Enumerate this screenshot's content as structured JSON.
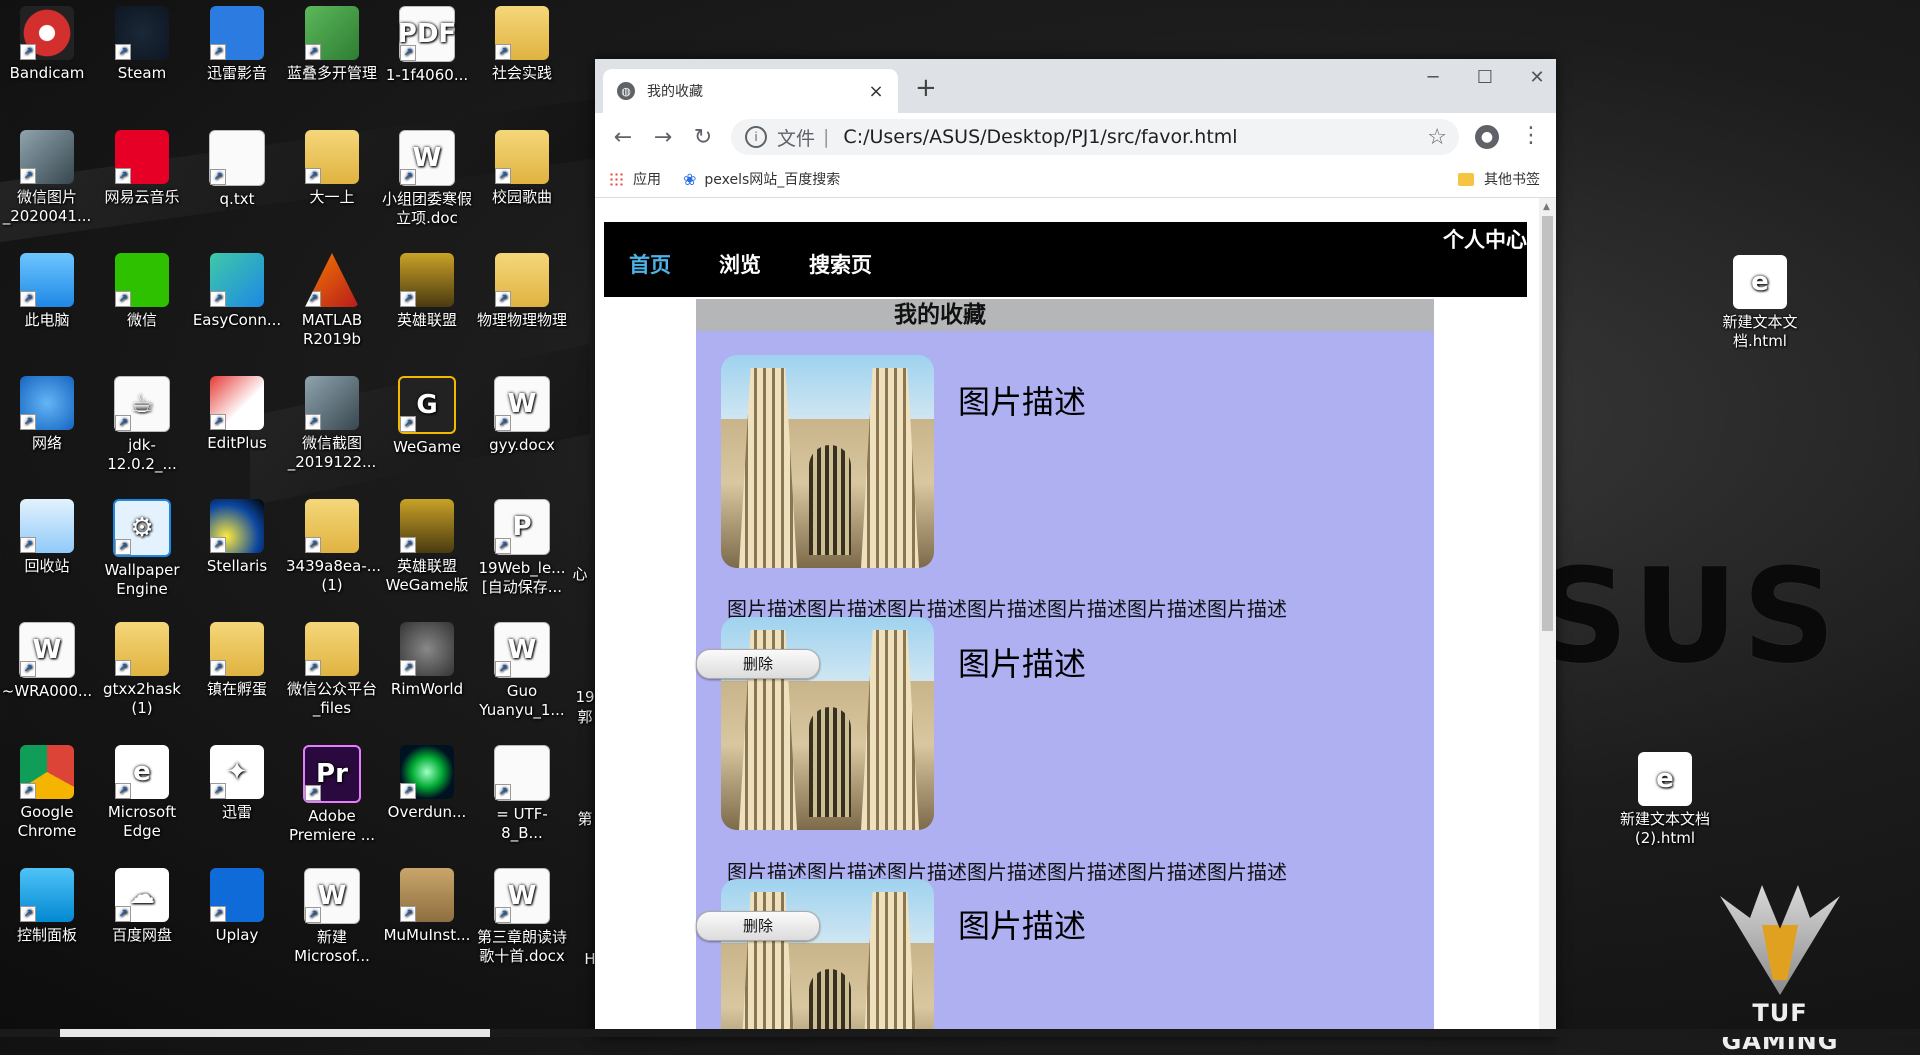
{
  "desktop": {
    "icons": [
      {
        "label": "Bandicam",
        "icon": "bandicam-icon"
      },
      {
        "label": "Steam",
        "icon": "steam-icon"
      },
      {
        "label": "迅雷影音",
        "icon": "xunlei-player-icon"
      },
      {
        "label": "蓝叠多开管理",
        "icon": "bluestacks-multi-icon"
      },
      {
        "label": "1-1f4060...",
        "icon": "pdf-file-icon"
      },
      {
        "label": "社会实践",
        "icon": "folder-icon"
      },
      {
        "label": "微信图片_2020041...",
        "icon": "image-file-icon"
      },
      {
        "label": "网易云音乐",
        "icon": "netease-music-icon"
      },
      {
        "label": "q.txt",
        "icon": "text-file-icon"
      },
      {
        "label": "大一上",
        "icon": "folder-icon"
      },
      {
        "label": "小组团委寒假立项.doc",
        "icon": "word-doc-icon"
      },
      {
        "label": "校园歌曲",
        "icon": "folder-icon"
      },
      {
        "label": "此电脑",
        "icon": "this-pc-icon"
      },
      {
        "label": "微信",
        "icon": "wechat-icon"
      },
      {
        "label": "EasyConn...",
        "icon": "easyconnect-icon"
      },
      {
        "label": "MATLAB R2019b",
        "icon": "matlab-icon"
      },
      {
        "label": "英雄联盟",
        "icon": "lol-icon"
      },
      {
        "label": "物理物理物理",
        "icon": "folder-icon"
      },
      {
        "label": "网络",
        "icon": "network-icon"
      },
      {
        "label": "jdk-12.0.2_...",
        "icon": "java-installer-icon"
      },
      {
        "label": "EditPlus",
        "icon": "editplus-icon"
      },
      {
        "label": "微信截图_2019122...",
        "icon": "image-file-icon"
      },
      {
        "label": "WeGame",
        "icon": "wegame-icon"
      },
      {
        "label": "gyy.docx",
        "icon": "word-doc-icon"
      },
      {
        "label": "回收站",
        "icon": "recycle-bin-icon"
      },
      {
        "label": "Wallpaper Engine",
        "icon": "wallpaper-engine-icon"
      },
      {
        "label": "Stellaris",
        "icon": "stellaris-icon"
      },
      {
        "label": "3439a8ea-...(1)",
        "icon": "folder-icon"
      },
      {
        "label": "英雄联盟WeGame版",
        "icon": "lol-icon"
      },
      {
        "label": "19Web_le...[自动保存...",
        "icon": "ppt-file-icon"
      },
      {
        "label": "~WRA000...",
        "icon": "word-doc-icon"
      },
      {
        "label": "gtxx2hask (1)",
        "icon": "archive-icon"
      },
      {
        "label": "镇在孵蛋",
        "icon": "folder-icon"
      },
      {
        "label": "微信公众平台_files",
        "icon": "folder-icon"
      },
      {
        "label": "RimWorld",
        "icon": "rimworld-icon"
      },
      {
        "label": "Guo Yuanyu_1...",
        "icon": "word-doc-icon"
      },
      {
        "label": "Google Chrome",
        "icon": "chrome-icon"
      },
      {
        "label": "Microsoft Edge",
        "icon": "edge-icon"
      },
      {
        "label": "迅雷",
        "icon": "xunlei-icon"
      },
      {
        "label": "Adobe Premiere ...",
        "icon": "premiere-icon"
      },
      {
        "label": "Overdun...",
        "icon": "overdungeon-icon"
      },
      {
        "label": "= UTF-8_B...",
        "icon": "file-icon"
      },
      {
        "label": "控制面板",
        "icon": "control-panel-icon"
      },
      {
        "label": "百度网盘",
        "icon": "baidu-netdisk-icon"
      },
      {
        "label": "Uplay",
        "icon": "uplay-icon"
      },
      {
        "label": "新建 Microsof...",
        "icon": "word-doc-icon"
      },
      {
        "label": "MuMuInst...",
        "icon": "mumu-installer-icon"
      },
      {
        "label": "第三章朗读诗歌十首.docx",
        "icon": "word-doc-icon"
      }
    ],
    "right_icons": [
      {
        "label": "新建文本文档.html",
        "icon": "edge-html-file-icon"
      },
      {
        "label": "新建文本文档 (2).html",
        "icon": "edge-html-file-icon"
      }
    ],
    "clipped_labels": [
      "心",
      "19",
      "郭",
      "第",
      "H"
    ],
    "wallpaper_brand": "SUS",
    "wallpaper_logo": "TUF GAMING"
  },
  "browser": {
    "tab": {
      "title": "我的收藏",
      "close": "×"
    },
    "new_tab": "+",
    "window_controls": {
      "minimize": "─",
      "maximize": "☐",
      "close": "✕"
    },
    "nav": {
      "back": "←",
      "forward": "→",
      "reload": "↻"
    },
    "omnibox": {
      "scheme_label": "文件",
      "separator": "|",
      "url": "C:/Users/ASUS/Desktop/PJ1/src/favor.html",
      "star": "☆"
    },
    "menu": "⋮",
    "bookmarks": [
      {
        "label": "应用",
        "icon": "apps-grid-icon"
      },
      {
        "label": "pexels网站_百度搜索",
        "icon": "baidu-paw-icon"
      }
    ],
    "other_bookmarks": "其他书签"
  },
  "site": {
    "nav": {
      "home": "首页",
      "browse": "浏览",
      "search": "搜索页",
      "personal": "个人中心"
    },
    "colors": {
      "nav_bg": "#000000",
      "active_link": "#4fb3e8",
      "panel_bg": "#aeb0f2",
      "header_bg": "#b4b6b8"
    },
    "favorites": {
      "header": "我的收藏",
      "items": [
        {
          "title": "图片描述",
          "description": "图片描述图片描述图片描述图片描述图片描述图片描述图片描述图片描述图片描述",
          "delete_label": "删除"
        },
        {
          "title": "图片描述",
          "description": "图片描述图片描述图片描述图片描述图片描述图片描述图片描述图片描述",
          "delete_label": "删除"
        },
        {
          "title": "图片描述",
          "description": "",
          "delete_label": ""
        }
      ]
    }
  }
}
